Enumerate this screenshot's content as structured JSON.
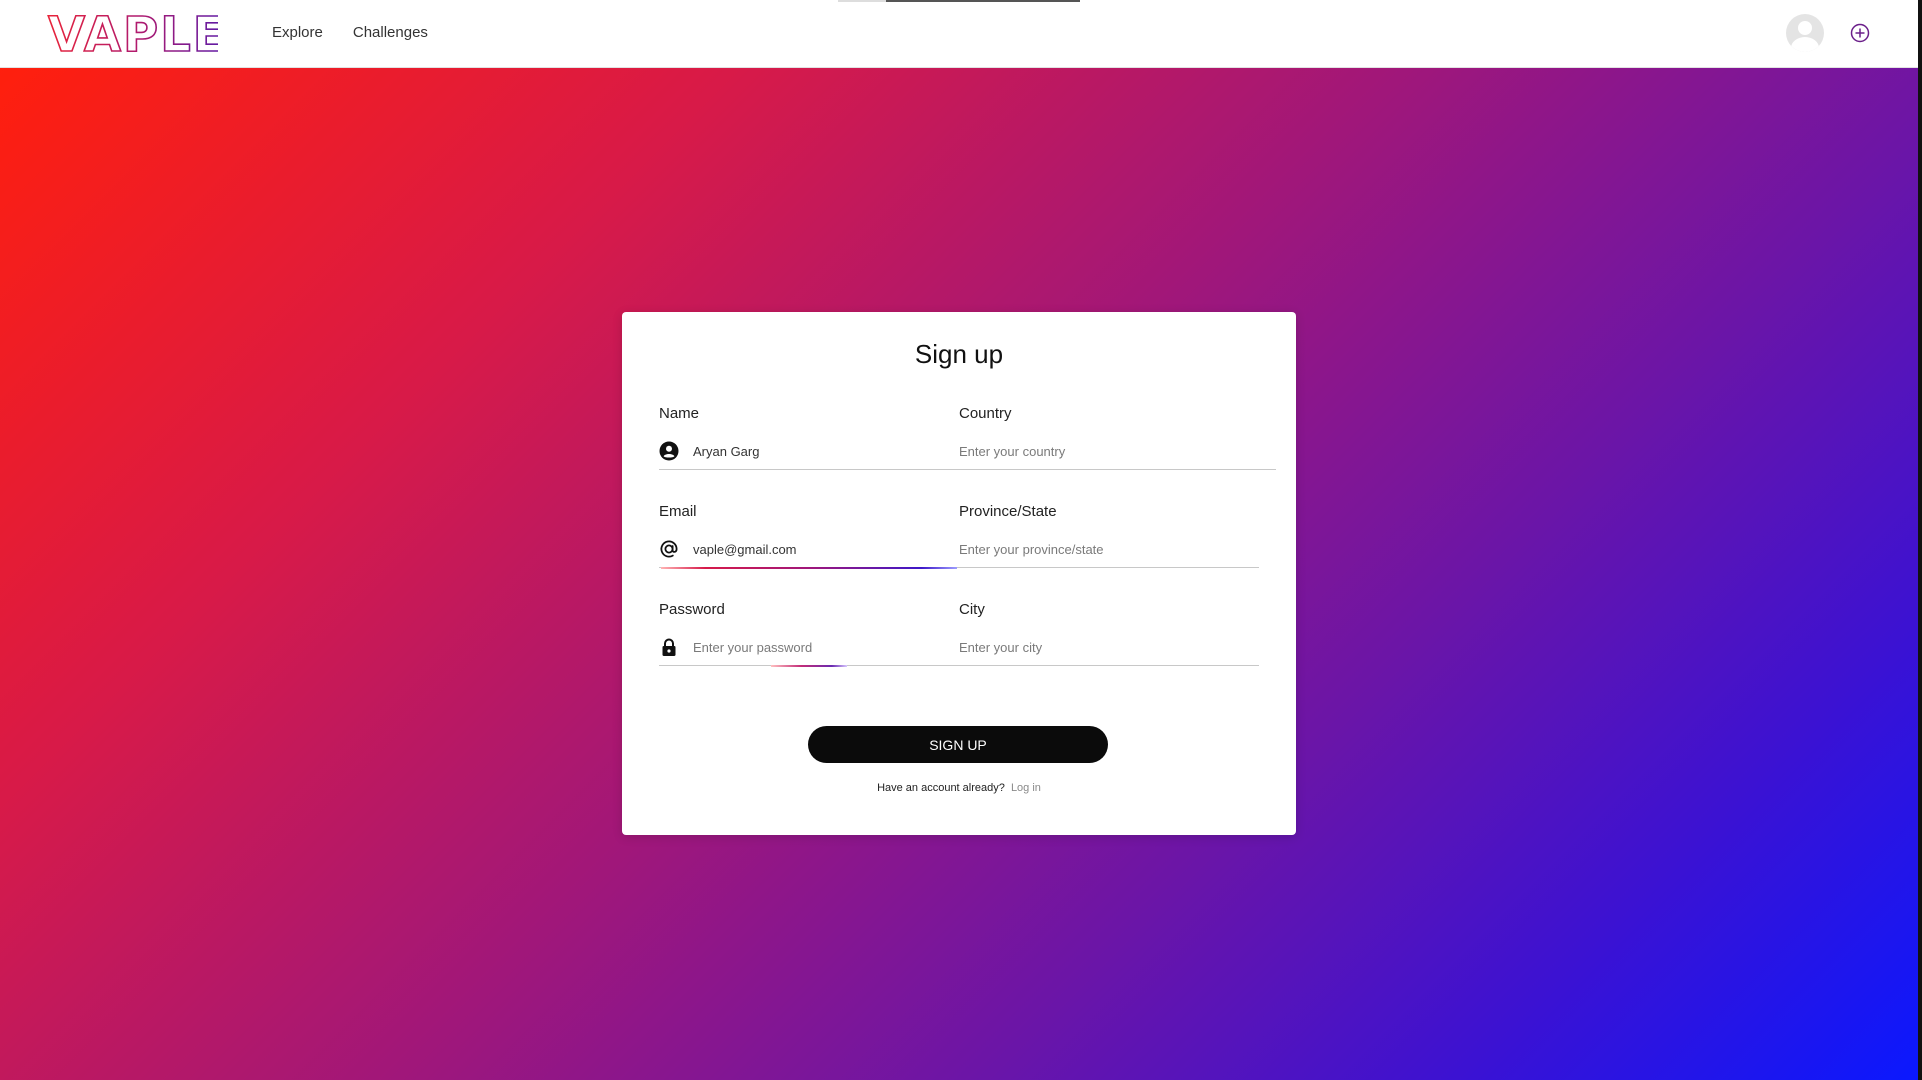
{
  "brand": {
    "logo_text": "VAPLE"
  },
  "nav": {
    "links": [
      {
        "label": "Explore"
      },
      {
        "label": "Challenges"
      }
    ]
  },
  "colors": {
    "gradient_start": "#ff1f0d",
    "gradient_mid": "#a0177a",
    "gradient_end": "#0a18ff",
    "button": "#0b0b0b"
  },
  "form": {
    "title": "Sign up",
    "name": {
      "label": "Name",
      "value": "Aryan Garg",
      "placeholder": "",
      "icon": "account-circle-icon"
    },
    "email": {
      "label": "Email",
      "value": "vaple@gmail.com",
      "placeholder": "",
      "icon": "at-sign-icon"
    },
    "password": {
      "label": "Password",
      "value": "",
      "placeholder": "Enter your password",
      "icon": "lock-icon"
    },
    "country": {
      "label": "Country",
      "value": "",
      "placeholder": "Enter your country"
    },
    "province": {
      "label": "Province/State",
      "value": "",
      "placeholder": "Enter your province/state"
    },
    "city": {
      "label": "City",
      "value": "",
      "placeholder": "Enter your city"
    },
    "submit_label": "SIGN UP",
    "login_prompt": "Have an account already?",
    "login_link": "Log in"
  }
}
